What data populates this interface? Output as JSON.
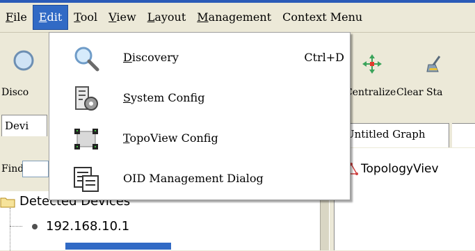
{
  "menubar": {
    "items": [
      {
        "label": "File",
        "mnemonic": "F",
        "rest": "ile"
      },
      {
        "label": "Edit",
        "mnemonic": "E",
        "rest": "dit"
      },
      {
        "label": "Tool",
        "mnemonic": "T",
        "rest": "ool"
      },
      {
        "label": "View",
        "mnemonic": "V",
        "rest": "iew"
      },
      {
        "label": "Layout",
        "mnemonic": "L",
        "rest": "ayout"
      },
      {
        "label": "Management",
        "mnemonic": "M",
        "rest": "anagement"
      },
      {
        "label": "Context Menu"
      }
    ],
    "active": "Edit"
  },
  "toolbar": {
    "discovery_label": "Disco",
    "centralize_label": "Centralize",
    "clear_label": "Clear Sta"
  },
  "edit_menu": {
    "items": [
      {
        "mnemonic": "D",
        "rest": "iscovery",
        "shortcut": "Ctrl+D",
        "icon": "magnifier-icon"
      },
      {
        "mnemonic": "S",
        "rest": "ystem Config",
        "icon": "system-config-icon"
      },
      {
        "mnemonic": "T",
        "rest": "opoView Config",
        "icon": "topoview-config-icon"
      },
      {
        "label": "OID Management Dialog",
        "icon": "oid-dialog-icon"
      }
    ]
  },
  "left_panel": {
    "tab_label": "Devi",
    "find_label": "Find",
    "tree": {
      "root_label": "Detected Devices",
      "nodes": [
        "192.168.10.1"
      ]
    }
  },
  "right_panel": {
    "tab_label": "Untitled Graph",
    "graph_title": "TopologyViev"
  },
  "colors": {
    "menu_highlight": "#316ac5",
    "window_bg": "#ece9d8",
    "top_strip": "#2b5bb8"
  }
}
